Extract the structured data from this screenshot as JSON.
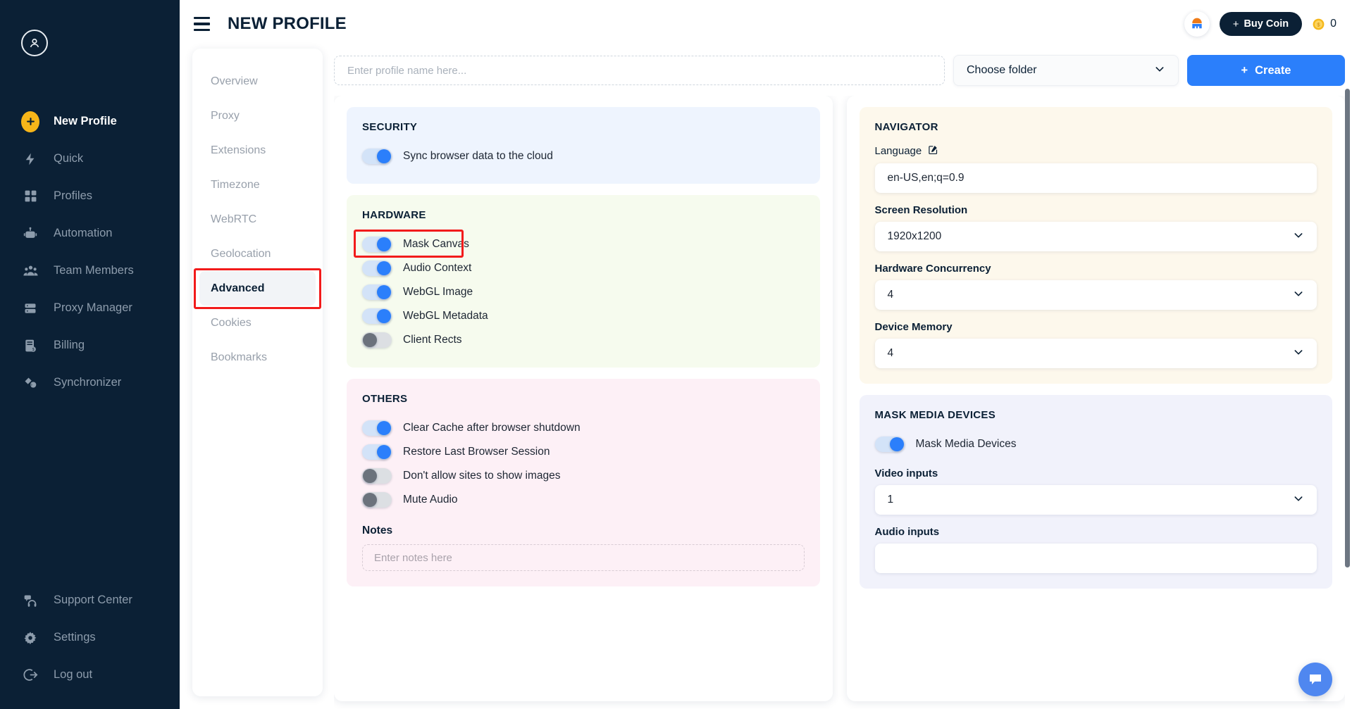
{
  "sidebar": {
    "avatar_icon": "user-circle-icon",
    "items": [
      {
        "label": "New Profile",
        "icon": "plus-circle-icon",
        "active": true
      },
      {
        "label": "Quick",
        "icon": "lightning-icon",
        "active": false
      },
      {
        "label": "Profiles",
        "icon": "grid-icon",
        "active": false
      },
      {
        "label": "Automation",
        "icon": "robot-icon",
        "active": false
      },
      {
        "label": "Team Members",
        "icon": "people-icon",
        "active": false
      },
      {
        "label": "Proxy Manager",
        "icon": "server-icon",
        "active": false
      },
      {
        "label": "Billing",
        "icon": "invoice-icon",
        "active": false
      },
      {
        "label": "Synchronizer",
        "icon": "sync-icon",
        "active": false
      }
    ],
    "bottom_items": [
      {
        "label": "Support Center",
        "icon": "headset-icon"
      },
      {
        "label": "Settings",
        "icon": "gear-icon"
      },
      {
        "label": "Log out",
        "icon": "logout-icon"
      }
    ]
  },
  "topbar": {
    "menu_icon": "hamburger-icon",
    "title": "NEW PROFILE",
    "app_icon": "app-logo-icon",
    "buy_coin_plus": "+",
    "buy_coin_label": "Buy Coin",
    "coin_icon": "coin-icon",
    "coin_amount": "0"
  },
  "tabs": {
    "items": [
      {
        "label": "Overview",
        "selected": false
      },
      {
        "label": "Proxy",
        "selected": false
      },
      {
        "label": "Extensions",
        "selected": false
      },
      {
        "label": "Timezone",
        "selected": false
      },
      {
        "label": "WebRTC",
        "selected": false
      },
      {
        "label": "Geolocation",
        "selected": false
      },
      {
        "label": "Advanced",
        "selected": true
      },
      {
        "label": "Cookies",
        "selected": false
      },
      {
        "label": "Bookmarks",
        "selected": false
      }
    ],
    "highlight_tab": "Advanced",
    "highlight_color": "#f21b1b"
  },
  "form": {
    "profile_name_value": "",
    "profile_name_placeholder": "Enter profile name here...",
    "folder_label": "Choose folder",
    "folder_chevron_icon": "chevron-down-icon",
    "create_plus": "+",
    "create_label": "Create",
    "create_color": "#2b7ffb"
  },
  "left_pane": {
    "security": {
      "title": "SECURITY",
      "toggles": [
        {
          "label": "Sync browser data to the cloud",
          "on": true
        }
      ]
    },
    "hardware": {
      "title": "HARDWARE",
      "toggles": [
        {
          "label": "Mask Canvas",
          "on": true,
          "highlighted": true
        },
        {
          "label": "Audio Context",
          "on": true,
          "highlighted": false
        },
        {
          "label": "WebGL Image",
          "on": true,
          "highlighted": false
        },
        {
          "label": "WebGL Metadata",
          "on": true,
          "highlighted": false
        },
        {
          "label": "Client Rects",
          "on": false,
          "highlighted": false
        }
      ]
    },
    "others": {
      "title": "OTHERS",
      "toggles": [
        {
          "label": "Clear Cache after browser shutdown",
          "on": true
        },
        {
          "label": "Restore Last Browser Session",
          "on": true
        },
        {
          "label": "Don't allow sites to show images",
          "on": false
        },
        {
          "label": "Mute Audio",
          "on": false
        }
      ],
      "notes_label": "Notes",
      "notes_value": "",
      "notes_placeholder": "Enter notes here"
    }
  },
  "right_pane": {
    "navigator": {
      "title": "NAVIGATOR",
      "language_label": "Language",
      "language_edit_icon": "edit-pencil-icon",
      "language_value": "en-US,en;q=0.9",
      "fields": [
        {
          "label": "Screen Resolution",
          "value": "1920x1200"
        },
        {
          "label": "Hardware Concurrency",
          "value": "4"
        },
        {
          "label": "Device Memory",
          "value": "4"
        }
      ]
    },
    "media": {
      "title": "MASK MEDIA DEVICES",
      "toggle": {
        "label": "Mask Media Devices",
        "on": true
      },
      "fields": [
        {
          "label": "Video inputs",
          "value": "1"
        },
        {
          "label": "Audio inputs",
          "value": ""
        }
      ]
    }
  },
  "chat": {
    "icon": "chat-bubble-icon",
    "color": "#4f87f0"
  },
  "scrollbar": {
    "name": "vertical-scrollbar"
  }
}
